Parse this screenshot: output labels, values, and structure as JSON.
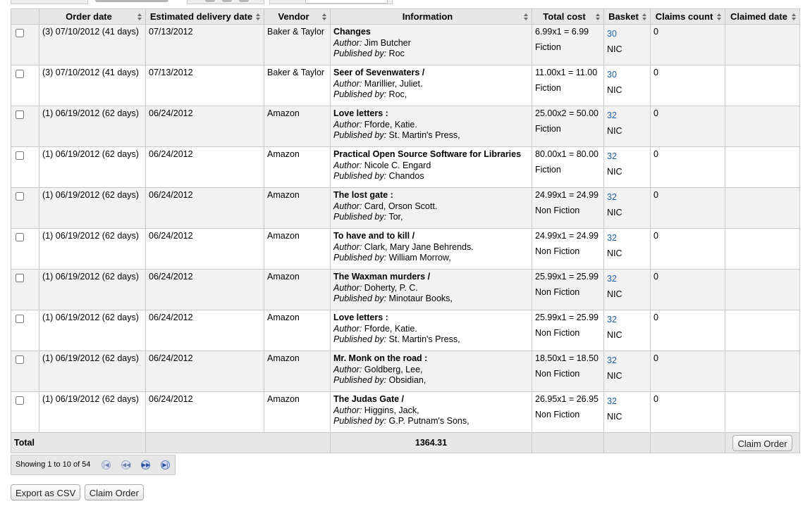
{
  "columns": {
    "order_date": "Order date",
    "est_delivery": "Estimated delivery date",
    "vendor": "Vendor",
    "information": "Information",
    "total_cost": "Total cost",
    "basket": "Basket",
    "claims_count": "Claims count",
    "claimed_date": "Claimed date"
  },
  "labels": {
    "author": "Author:",
    "published_by": "Published by:"
  },
  "rows": [
    {
      "order_date": "(3) 07/10/2012 (41 days)",
      "est_delivery": "07/13/2012",
      "vendor": "Baker & Taylor",
      "title": "Changes",
      "author": "Jim Butcher",
      "publisher": "Roc",
      "cost": "6.99x1 = 6.99",
      "fund": "Fiction",
      "basket": "30",
      "branch": "NIC",
      "claims": "0",
      "claimed_date": ""
    },
    {
      "order_date": "(3) 07/10/2012 (41 days)",
      "est_delivery": "07/13/2012",
      "vendor": "Baker & Taylor",
      "title": "Seer of Sevenwaters /",
      "author": "Marillier, Juliet.",
      "publisher": "Roc,",
      "cost": "11.00x1 = 11.00",
      "fund": "Fiction",
      "basket": "30",
      "branch": "NIC",
      "claims": "0",
      "claimed_date": ""
    },
    {
      "order_date": "(1) 06/19/2012 (62 days)",
      "est_delivery": "06/24/2012",
      "vendor": "Amazon",
      "title": "Love letters :",
      "author": "Fforde, Katie.",
      "publisher": "St. Martin's Press,",
      "cost": "25.00x2 = 50.00",
      "fund": "Fiction",
      "basket": "32",
      "branch": "NIC",
      "claims": "0",
      "claimed_date": ""
    },
    {
      "order_date": "(1) 06/19/2012 (62 days)",
      "est_delivery": "06/24/2012",
      "vendor": "Amazon",
      "title": "Practical Open Source Software for Libraries",
      "author": "Nicole C. Engard",
      "publisher": "Chandos",
      "cost": "80.00x1 = 80.00",
      "fund": "Fiction",
      "basket": "32",
      "branch": "NIC",
      "claims": "0",
      "claimed_date": ""
    },
    {
      "order_date": "(1) 06/19/2012 (62 days)",
      "est_delivery": "06/24/2012",
      "vendor": "Amazon",
      "title": "The lost gate :",
      "author": "Card, Orson Scott.",
      "publisher": "Tor,",
      "cost": "24.99x1 = 24.99",
      "fund": "Non Fiction",
      "basket": "32",
      "branch": "NIC",
      "claims": "0",
      "claimed_date": ""
    },
    {
      "order_date": "(1) 06/19/2012 (62 days)",
      "est_delivery": "06/24/2012",
      "vendor": "Amazon",
      "title": "To have and to kill /",
      "author": "Clark, Mary Jane Behrends.",
      "publisher": "William Morrow,",
      "cost": "24.99x1 = 24.99",
      "fund": "Non Fiction",
      "basket": "32",
      "branch": "NIC",
      "claims": "0",
      "claimed_date": ""
    },
    {
      "order_date": "(1) 06/19/2012 (62 days)",
      "est_delivery": "06/24/2012",
      "vendor": "Amazon",
      "title": "The Waxman murders /",
      "author": "Doherty, P. C.",
      "publisher": "Minotaur Books,",
      "cost": "25.99x1 = 25.99",
      "fund": "Non Fiction",
      "basket": "32",
      "branch": "NIC",
      "claims": "0",
      "claimed_date": ""
    },
    {
      "order_date": "(1) 06/19/2012 (62 days)",
      "est_delivery": "06/24/2012",
      "vendor": "Amazon",
      "title": "Love letters :",
      "author": "Fforde, Katie.",
      "publisher": "St. Martin's Press,",
      "cost": "25.99x1 = 25.99",
      "fund": "Non Fiction",
      "basket": "32",
      "branch": "NIC",
      "claims": "0",
      "claimed_date": ""
    },
    {
      "order_date": "(1) 06/19/2012 (62 days)",
      "est_delivery": "06/24/2012",
      "vendor": "Amazon",
      "title": "Mr. Monk on the road :",
      "author": "Goldberg, Lee,",
      "publisher": "Obsidian,",
      "cost": "18.50x1 = 18.50",
      "fund": "Non Fiction",
      "basket": "32",
      "branch": "NIC",
      "claims": "0",
      "claimed_date": ""
    },
    {
      "order_date": "(1) 06/19/2012 (62 days)",
      "est_delivery": "06/24/2012",
      "vendor": "Amazon",
      "title": "The Judas Gate /",
      "author": "Higgins, Jack,",
      "publisher": "G.P. Putnam's Sons,",
      "cost": "26.95x1 = 26.95",
      "fund": "Non Fiction",
      "basket": "32",
      "branch": "NIC",
      "claims": "0",
      "claimed_date": ""
    }
  ],
  "footer": {
    "total_label": "Total",
    "total_value": "1364.31",
    "claim_order_label": "Claim Order"
  },
  "pagination": {
    "info": "Showing 1 to 10 of 54",
    "first_icon": "first-page-icon",
    "prev_icon": "previous-page-icon",
    "next_icon": "next-page-icon",
    "last_icon": "last-page-icon"
  },
  "actions": {
    "export_csv": "Export as CSV",
    "claim_order": "Claim Order"
  },
  "colors": {
    "header_bg": "#e7e7e7",
    "odd_row": "#f2f2f2",
    "link": "#1e5ea8",
    "border": "#c9c9c9"
  }
}
